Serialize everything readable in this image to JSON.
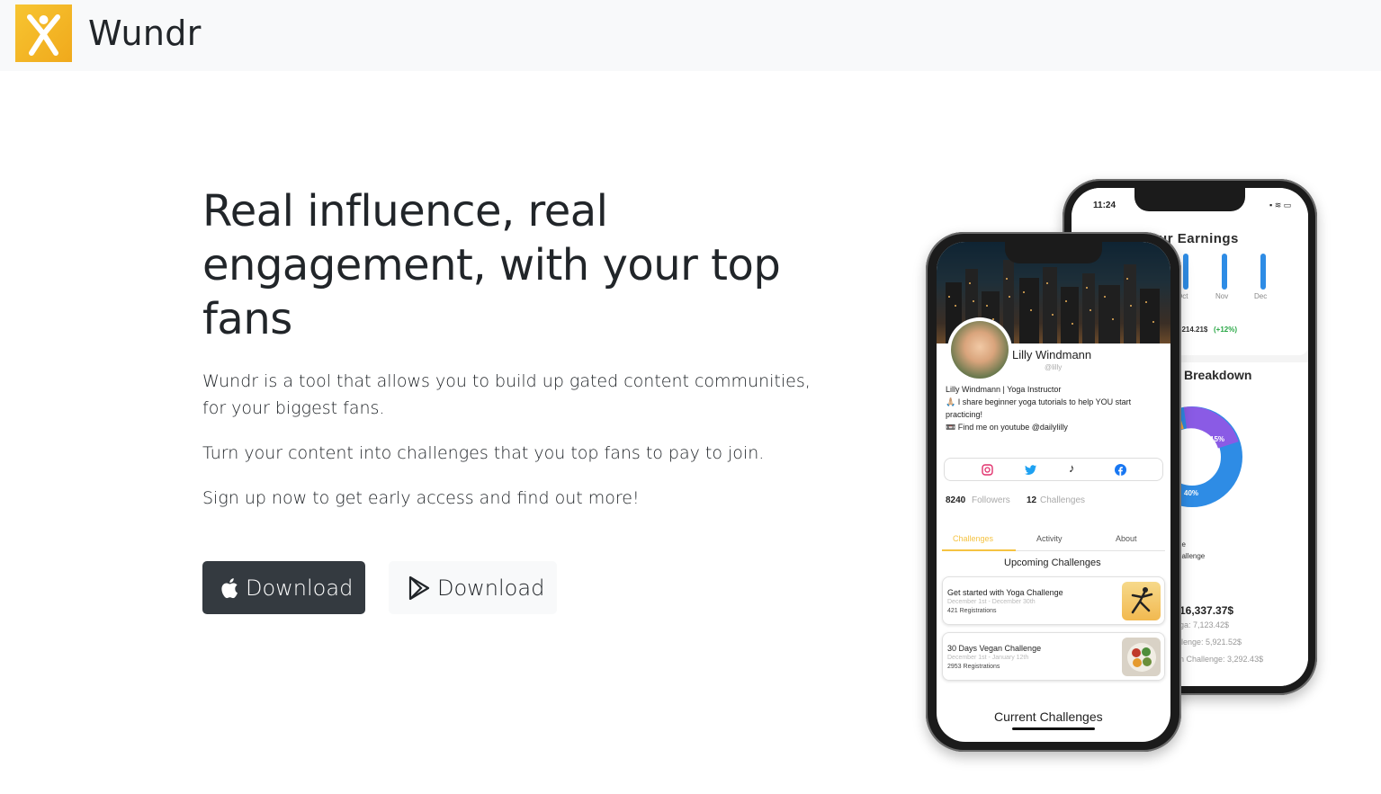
{
  "navbar": {
    "brand_name": "Wundr"
  },
  "hero": {
    "title": "Real influence, real engagement, with your top fans",
    "paragraph_1": "Wundr is a tool that allows you to build up gated content communities, for your biggest fans.",
    "paragraph_2": "Turn your content into challenges that you top fans to pay to join.",
    "paragraph_3": "Sign up now to get early access and find out more!",
    "apple_button_label": "Download",
    "play_button_label": "Download"
  },
  "back_phone": {
    "time": "11:24",
    "title": "Your Earnings",
    "months": [
      "Oct",
      "Nov",
      "Dec"
    ],
    "earnings_summary_value": "6214.21$",
    "earnings_summary_change": "(+12%)",
    "breakdown_title": "Breakdown",
    "donut_labels": [
      "15%",
      "40%"
    ],
    "legend_fragments": [
      "ge",
      "hallenge"
    ],
    "total": "16,337.37$",
    "lines": [
      "ga: 7,123.42$",
      "llenge: 5,921.52$",
      "n Challenge: 3,292.43$"
    ],
    "colors": {
      "blue": "#2e8ce5",
      "orange": "#f4a93c",
      "purple": "#8a5be5",
      "green": "#28a745"
    }
  },
  "front_phone": {
    "name": "Lilly Windmann",
    "handle": "@lilly",
    "bio_line_1": "Lilly Windmann | Yoga Instructor",
    "bio_line_2": "🙏🏼 I share beginner yoga tutorials to help YOU start",
    "bio_line_3": "practicing!",
    "bio_line_4": "📼 Find me on youtube @dailylilly",
    "followers_count": "8240",
    "followers_label": "Followers",
    "challenges_count": "12",
    "challenges_label": "Challenges",
    "tabs": [
      "Challenges",
      "Activity",
      "About"
    ],
    "upcoming_title": "Upcoming Challenges",
    "challenges": [
      {
        "title": "Get started with Yoga Challenge",
        "dates": "December 1st - December 30th",
        "registrations": "421 Registrations"
      },
      {
        "title": "30 Days Vegan Challenge",
        "dates": "December 1st - January 12th",
        "registrations": "2953 Registrations"
      }
    ],
    "current_title": "Current Challenges",
    "accent": "#f5c342"
  }
}
